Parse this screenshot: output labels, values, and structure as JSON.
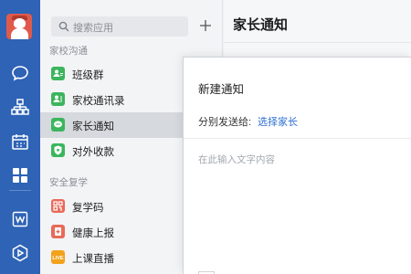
{
  "search": {
    "placeholder": "搜索应用"
  },
  "sections": [
    {
      "label": "家校沟通",
      "items": [
        {
          "label": "班级群",
          "icon": "class-group-icon",
          "color": "#3cb55e"
        },
        {
          "label": "家校通讯录",
          "icon": "contacts-icon",
          "color": "#3cb55e"
        },
        {
          "label": "家长通知",
          "icon": "notice-bubble-icon",
          "color": "#3cb55e",
          "selected": true
        },
        {
          "label": "对外收款",
          "icon": "payment-shield-icon",
          "color": "#3cb55e"
        }
      ]
    },
    {
      "label": "安全复学",
      "items": [
        {
          "label": "复学码",
          "icon": "qr-code-icon",
          "color": "#e86a5a"
        },
        {
          "label": "健康上报",
          "icon": "health-report-icon",
          "color": "#e86a5a"
        },
        {
          "label": "上课直播",
          "icon": "live-icon",
          "color": "#f2a21b",
          "badge": "LIVE"
        }
      ]
    }
  ],
  "main": {
    "title": "家长通知"
  },
  "modal": {
    "title": "新建通知",
    "recipient_label": "分别发送给:",
    "recipient_link": "选择家长",
    "content_placeholder": "在此输入文字内容"
  },
  "colors": {
    "rail": "#2e63b6",
    "accent": "#2e6fd1",
    "green": "#3cb55e",
    "red": "#e86a5a",
    "orange": "#f2a21b"
  }
}
